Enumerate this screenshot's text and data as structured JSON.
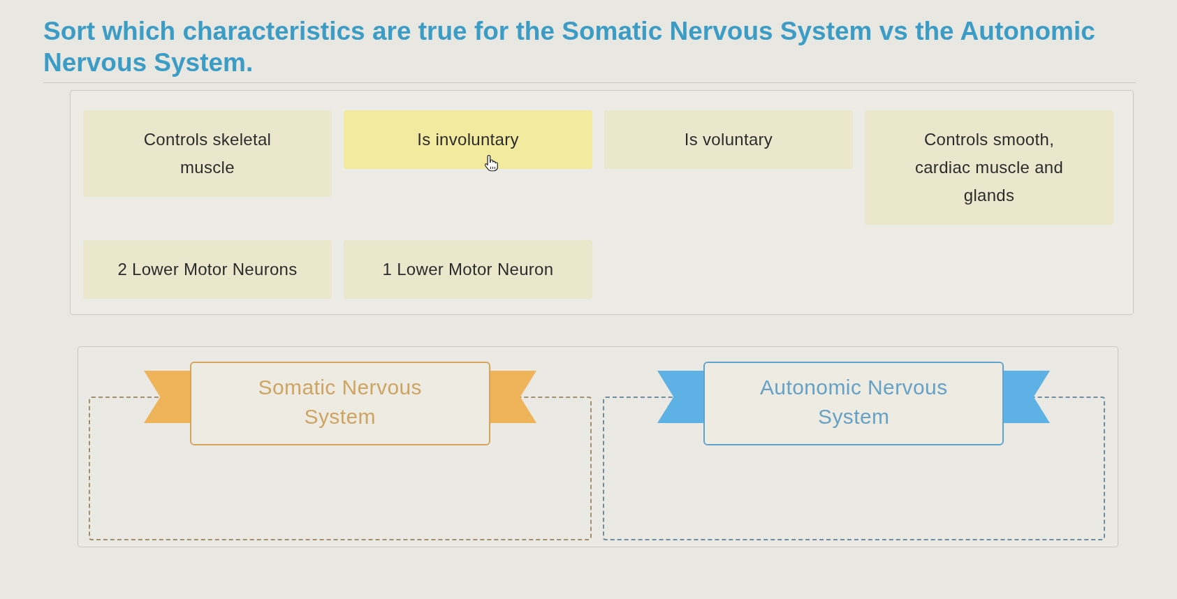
{
  "title": "Sort which characteristics are true for the Somatic Nervous System vs the Autonomic Nervous System.",
  "cards": [
    {
      "text": "Controls skeletal muscle",
      "hovered": false
    },
    {
      "text": "Is involuntary",
      "hovered": true
    },
    {
      "text": "Is voluntary",
      "hovered": false
    },
    {
      "text": "Controls smooth, cardiac muscle and glands",
      "hovered": false
    },
    {
      "text": "2 Lower Motor Neurons",
      "hovered": false
    },
    {
      "text": "1 Lower Motor Neuron",
      "hovered": false
    }
  ],
  "categories": [
    {
      "label": "Somatic Nervous System",
      "color": "#efb45a"
    },
    {
      "label": "Autonomic Nervous System",
      "color": "#5db1e4"
    }
  ]
}
